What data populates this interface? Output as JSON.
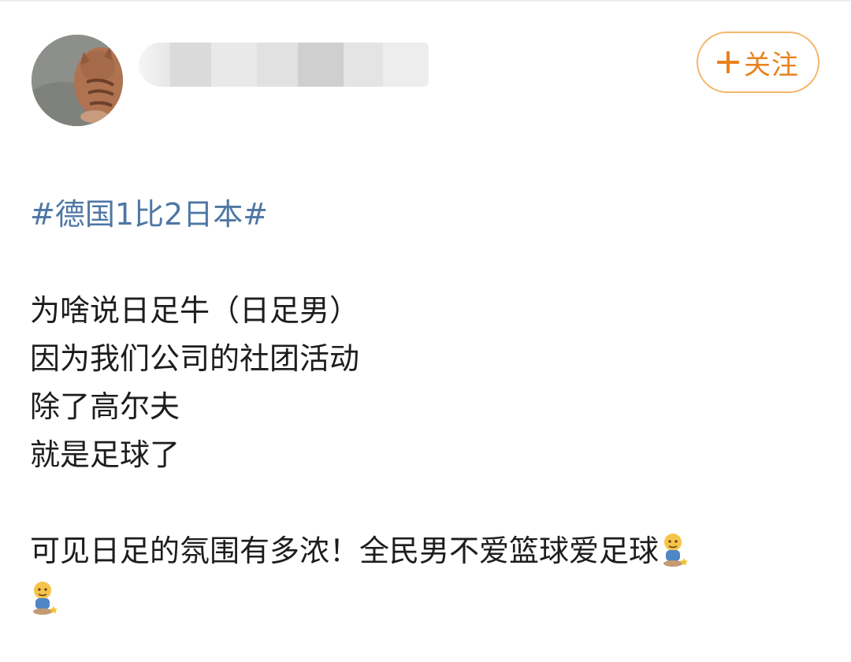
{
  "author": {
    "avatar": "cat-avatar-icon",
    "name_obscured": true
  },
  "follow_button": {
    "label": "关注",
    "icon": "plus-icon",
    "color": "#e8821e",
    "border_color": "#f5b66a"
  },
  "post": {
    "hashtag": "#德国1比2日本#",
    "hashtag_color": "#4e77a5",
    "paragraph1": [
      "为啥说日足牛（日足男）",
      "因为我们公司的社团活动",
      "除了高尔夫",
      "就是足球了"
    ],
    "paragraph2_line1": "可见日足的氛围有多浓！全民男不爱篮球爱足球",
    "emoji": "thinking-kid-emoji-icon"
  }
}
